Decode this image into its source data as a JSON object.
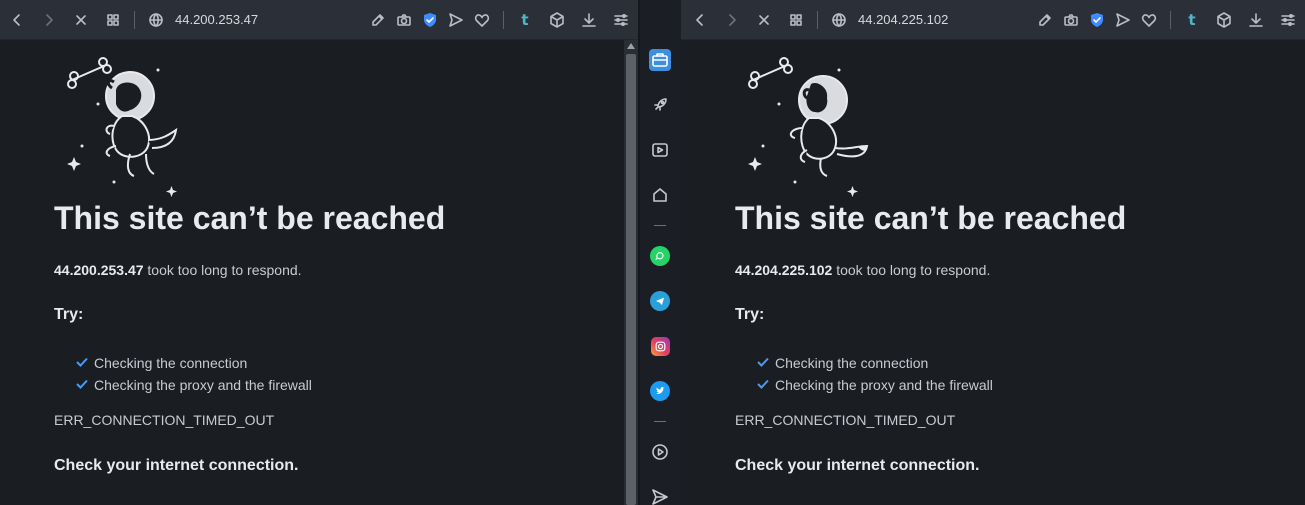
{
  "left_tab": {
    "url": "44.200.253.47",
    "page": {
      "headline": "This site can’t be reached",
      "host": "44.200.253.47",
      "message_suffix": " took too long to respond.",
      "try_label": "Try:",
      "suggestions": [
        "Checking the connection",
        "Checking the proxy and the firewall"
      ],
      "error_code": "ERR_CONNECTION_TIMED_OUT",
      "check_internet": "Check your internet connection."
    }
  },
  "right_tab": {
    "url": "44.204.225.102",
    "page": {
      "headline": "This site can’t be reached",
      "host": "44.204.225.102",
      "message_suffix": " took too long to respond.",
      "try_label": "Try:",
      "suggestions": [
        "Checking the connection",
        "Checking the proxy and the firewall"
      ],
      "error_code": "ERR_CONNECTION_TIMED_OUT",
      "check_internet": "Check your internet connection."
    }
  },
  "toolbar_icons": [
    "back-icon",
    "forward-icon",
    "stop-icon",
    "tabs-grid-icon",
    "globe-icon",
    "edit-icon",
    "camera-icon",
    "shield-icon",
    "send-icon",
    "heart-icon",
    "tumblr-icon",
    "cube-icon",
    "download-icon",
    "menu-icon"
  ],
  "toolbar_tumblr_glyph": "t",
  "sidebar_icons": [
    "briefcase-icon",
    "rocket-icon",
    "video-icon",
    "home-icon",
    "whatsapp-icon",
    "telegram-icon",
    "instagram-icon",
    "twitter-icon",
    "play-circle-icon",
    "send-icon"
  ],
  "colors": {
    "accent": "#3b8ee0",
    "check": "#4c9bf0",
    "page_bg": "#1a1d22",
    "toolbar_bg": "#2b2f37"
  }
}
